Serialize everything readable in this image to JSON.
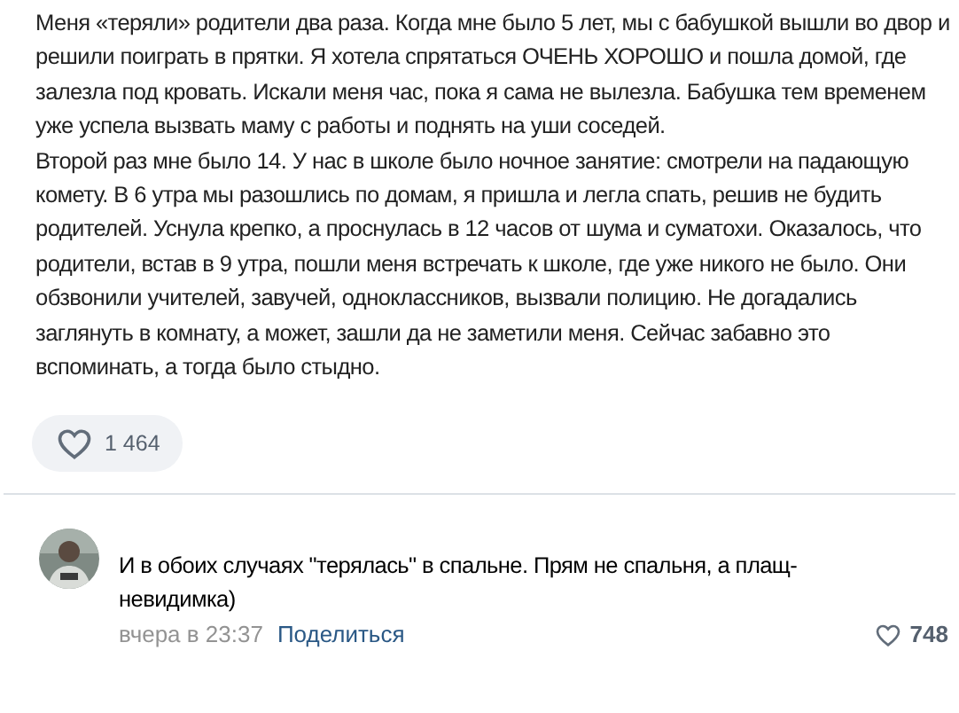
{
  "post": {
    "paragraphs": [
      "Меня «теряли» родители два раза. Когда мне было 5 лет, мы с бабушкой вышли во двор и решили поиграть в прятки. Я хотела спрятаться ОЧЕНЬ ХОРОШО и пошла домой, где залезла под кровать. Искали меня час, пока я сама не вылезла. Бабушка тем временем уже успела вызвать маму с работы и поднять на уши соседей.",
      "Второй раз мне было 14. У нас в школе было ночное занятие: смотрели на падающую комету. В 6 утра мы разошлись по домам, я пришла и легла спать, решив не будить родителей. Уснула крепко, а проснулась в 12 часов от шума и суматохи. Оказалось, что родители, встав в 9 утра, пошли меня встречать к школе, где уже никого не было. Они обзвонили учителей, завучей, одноклассников, вызвали полицию. Не догадались заглянуть в комнату, а может, зашли да не заметили меня. Сейчас забавно это вспоминать, а тогда было стыдно."
    ],
    "likes": "1 464"
  },
  "comment": {
    "text": "И в обоих случаях \"терялась\" в спальне. Прям не спальня, а плащ-невидимка)",
    "time": "вчера в 23:37",
    "share": "Поделиться",
    "likes": "748"
  }
}
